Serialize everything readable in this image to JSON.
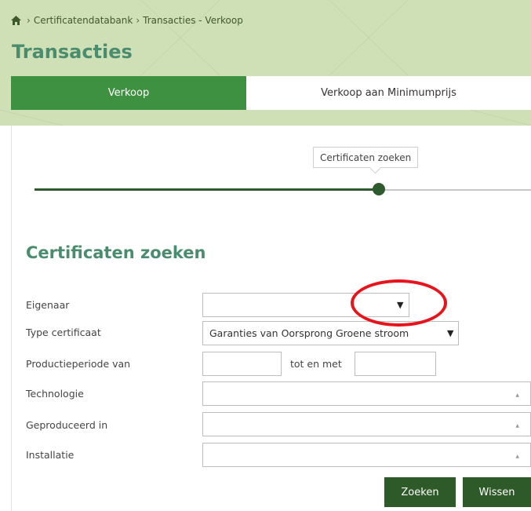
{
  "breadcrumb": {
    "items": [
      "Certificatendatabank",
      "Transacties - Verkoop"
    ]
  },
  "page": {
    "title": "Transacties"
  },
  "tabs": [
    {
      "label": "Verkoop",
      "active": true
    },
    {
      "label": "Verkoop aan Minimumprijs",
      "active": false
    }
  ],
  "stepper": {
    "current_step_label": "Certificaten zoeken"
  },
  "section": {
    "title": "Certificaten zoeken"
  },
  "form": {
    "eigenaar_label": "Eigenaar",
    "eigenaar_value": "",
    "type_label": "Type certificaat",
    "type_value": "Garanties van Oorsprong Groene stroom",
    "periode_label": "Productieperiode van",
    "periode_van_value": "",
    "tot_en_met_label": "tot en met",
    "periode_tot_value": "",
    "technologie_label": "Technologie",
    "geproduceerd_label": "Geproduceerd in",
    "installatie_label": "Installatie"
  },
  "buttons": {
    "zoeken": "Zoeken",
    "wissen": "Wissen"
  },
  "colors": {
    "header_bg": "#cfe0b6",
    "tab_active": "#3f9142",
    "title_green": "#4a8c6e",
    "button_dark_green": "#2d5a28",
    "highlight_red": "#e8141b"
  },
  "icons": {
    "home": "home-icon",
    "select_arrow": "triangle-down-icon",
    "multi_select": "triangle-up-icon"
  }
}
